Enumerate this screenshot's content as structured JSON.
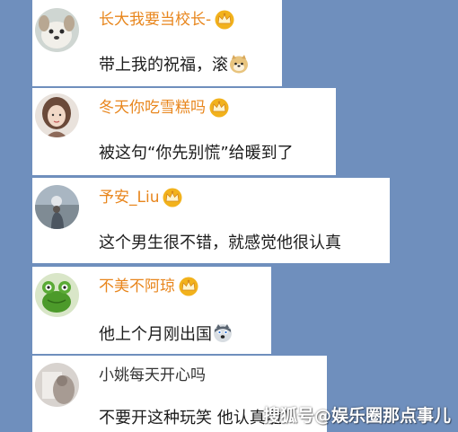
{
  "comments": [
    {
      "username": "长大我要当校长-",
      "has_crown": true,
      "text": "带上我的祝福，滚",
      "emoji": "doge-emoji"
    },
    {
      "username": "冬天你吃雪糕吗",
      "has_crown": true,
      "text": "被这句“你先别慌”给暖到了",
      "emoji": ""
    },
    {
      "username": "予安_Liu",
      "has_crown": true,
      "text": "这个男生很不错，就感觉他很认真",
      "emoji": ""
    },
    {
      "username": "不美不阿琼",
      "has_crown": true,
      "text": "他上个月刚出国",
      "emoji": "husky-emoji"
    },
    {
      "username": "小姚每天开心吗",
      "has_crown": false,
      "text": "不要开这种玩笑 他认真啦！",
      "emoji": ""
    }
  ],
  "watermark": "搜狐号@娱乐圈那点事儿",
  "colors": {
    "background": "#6f8fbd",
    "username": "#e8861d",
    "text": "#1c1c1c",
    "crown": "#f2b21c"
  },
  "icons": {
    "crown": "crown-badge-icon"
  }
}
